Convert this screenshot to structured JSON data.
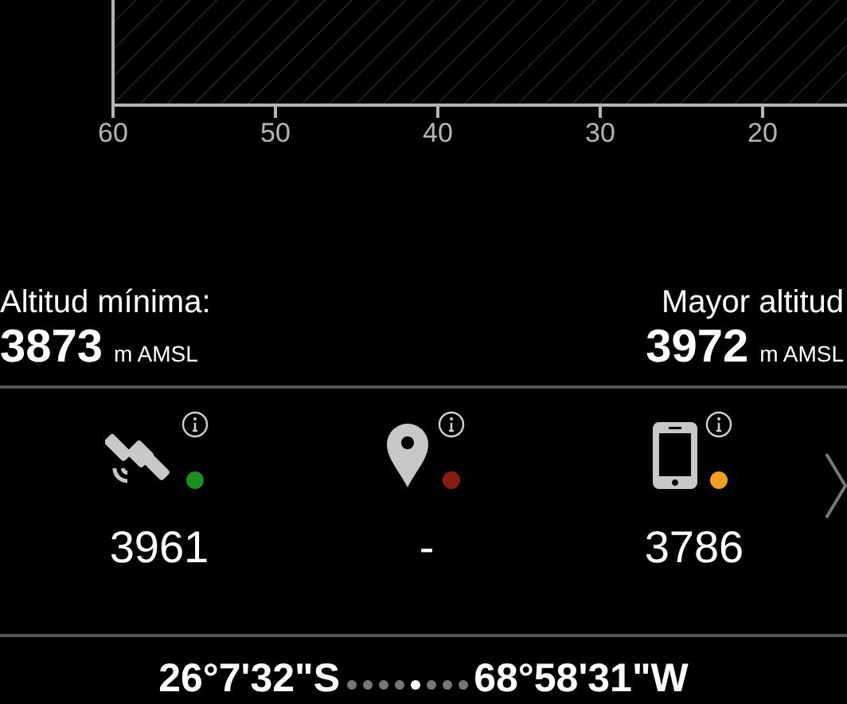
{
  "chart": {
    "x_tick_labels": [
      "60",
      "50",
      "40",
      "30",
      "20"
    ]
  },
  "altitude": {
    "min": {
      "label": "Altitud mínima:",
      "value": "3873",
      "unit": "m AMSL"
    },
    "max": {
      "label": "Mayor altitud",
      "value": "3972",
      "unit": "m AMSL"
    }
  },
  "sources": [
    {
      "kind": "satellite",
      "value": "3961",
      "color": "#1a8f1a"
    },
    {
      "kind": "pin",
      "value": "-",
      "color": "#8b1a10"
    },
    {
      "kind": "phone",
      "value": "3786",
      "color": "#f0a020"
    }
  ],
  "coordinates": {
    "latitude": "26°7'32\"S",
    "longitude": "68°58'31\"W"
  },
  "pages": [
    {
      "selected": false
    },
    {
      "selected": false
    },
    {
      "selected": false
    },
    {
      "selected": false
    },
    {
      "selected": true
    },
    {
      "selected": false
    },
    {
      "selected": false
    },
    {
      "selected": false
    }
  ]
}
